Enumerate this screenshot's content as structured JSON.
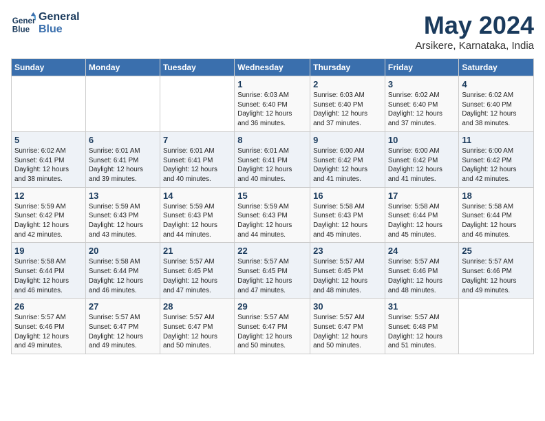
{
  "header": {
    "logo_line1": "General",
    "logo_line2": "Blue",
    "title": "May 2024",
    "location": "Arsikere, Karnataka, India"
  },
  "days_of_week": [
    "Sunday",
    "Monday",
    "Tuesday",
    "Wednesday",
    "Thursday",
    "Friday",
    "Saturday"
  ],
  "weeks": [
    [
      {
        "day": "",
        "info": ""
      },
      {
        "day": "",
        "info": ""
      },
      {
        "day": "",
        "info": ""
      },
      {
        "day": "1",
        "info": "Sunrise: 6:03 AM\nSunset: 6:40 PM\nDaylight: 12 hours\nand 36 minutes."
      },
      {
        "day": "2",
        "info": "Sunrise: 6:03 AM\nSunset: 6:40 PM\nDaylight: 12 hours\nand 37 minutes."
      },
      {
        "day": "3",
        "info": "Sunrise: 6:02 AM\nSunset: 6:40 PM\nDaylight: 12 hours\nand 37 minutes."
      },
      {
        "day": "4",
        "info": "Sunrise: 6:02 AM\nSunset: 6:40 PM\nDaylight: 12 hours\nand 38 minutes."
      }
    ],
    [
      {
        "day": "5",
        "info": "Sunrise: 6:02 AM\nSunset: 6:41 PM\nDaylight: 12 hours\nand 38 minutes."
      },
      {
        "day": "6",
        "info": "Sunrise: 6:01 AM\nSunset: 6:41 PM\nDaylight: 12 hours\nand 39 minutes."
      },
      {
        "day": "7",
        "info": "Sunrise: 6:01 AM\nSunset: 6:41 PM\nDaylight: 12 hours\nand 40 minutes."
      },
      {
        "day": "8",
        "info": "Sunrise: 6:01 AM\nSunset: 6:41 PM\nDaylight: 12 hours\nand 40 minutes."
      },
      {
        "day": "9",
        "info": "Sunrise: 6:00 AM\nSunset: 6:42 PM\nDaylight: 12 hours\nand 41 minutes."
      },
      {
        "day": "10",
        "info": "Sunrise: 6:00 AM\nSunset: 6:42 PM\nDaylight: 12 hours\nand 41 minutes."
      },
      {
        "day": "11",
        "info": "Sunrise: 6:00 AM\nSunset: 6:42 PM\nDaylight: 12 hours\nand 42 minutes."
      }
    ],
    [
      {
        "day": "12",
        "info": "Sunrise: 5:59 AM\nSunset: 6:42 PM\nDaylight: 12 hours\nand 42 minutes."
      },
      {
        "day": "13",
        "info": "Sunrise: 5:59 AM\nSunset: 6:43 PM\nDaylight: 12 hours\nand 43 minutes."
      },
      {
        "day": "14",
        "info": "Sunrise: 5:59 AM\nSunset: 6:43 PM\nDaylight: 12 hours\nand 44 minutes."
      },
      {
        "day": "15",
        "info": "Sunrise: 5:59 AM\nSunset: 6:43 PM\nDaylight: 12 hours\nand 44 minutes."
      },
      {
        "day": "16",
        "info": "Sunrise: 5:58 AM\nSunset: 6:43 PM\nDaylight: 12 hours\nand 45 minutes."
      },
      {
        "day": "17",
        "info": "Sunrise: 5:58 AM\nSunset: 6:44 PM\nDaylight: 12 hours\nand 45 minutes."
      },
      {
        "day": "18",
        "info": "Sunrise: 5:58 AM\nSunset: 6:44 PM\nDaylight: 12 hours\nand 46 minutes."
      }
    ],
    [
      {
        "day": "19",
        "info": "Sunrise: 5:58 AM\nSunset: 6:44 PM\nDaylight: 12 hours\nand 46 minutes."
      },
      {
        "day": "20",
        "info": "Sunrise: 5:58 AM\nSunset: 6:44 PM\nDaylight: 12 hours\nand 46 minutes."
      },
      {
        "day": "21",
        "info": "Sunrise: 5:57 AM\nSunset: 6:45 PM\nDaylight: 12 hours\nand 47 minutes."
      },
      {
        "day": "22",
        "info": "Sunrise: 5:57 AM\nSunset: 6:45 PM\nDaylight: 12 hours\nand 47 minutes."
      },
      {
        "day": "23",
        "info": "Sunrise: 5:57 AM\nSunset: 6:45 PM\nDaylight: 12 hours\nand 48 minutes."
      },
      {
        "day": "24",
        "info": "Sunrise: 5:57 AM\nSunset: 6:46 PM\nDaylight: 12 hours\nand 48 minutes."
      },
      {
        "day": "25",
        "info": "Sunrise: 5:57 AM\nSunset: 6:46 PM\nDaylight: 12 hours\nand 49 minutes."
      }
    ],
    [
      {
        "day": "26",
        "info": "Sunrise: 5:57 AM\nSunset: 6:46 PM\nDaylight: 12 hours\nand 49 minutes."
      },
      {
        "day": "27",
        "info": "Sunrise: 5:57 AM\nSunset: 6:47 PM\nDaylight: 12 hours\nand 49 minutes."
      },
      {
        "day": "28",
        "info": "Sunrise: 5:57 AM\nSunset: 6:47 PM\nDaylight: 12 hours\nand 50 minutes."
      },
      {
        "day": "29",
        "info": "Sunrise: 5:57 AM\nSunset: 6:47 PM\nDaylight: 12 hours\nand 50 minutes."
      },
      {
        "day": "30",
        "info": "Sunrise: 5:57 AM\nSunset: 6:47 PM\nDaylight: 12 hours\nand 50 minutes."
      },
      {
        "day": "31",
        "info": "Sunrise: 5:57 AM\nSunset: 6:48 PM\nDaylight: 12 hours\nand 51 minutes."
      },
      {
        "day": "",
        "info": ""
      }
    ]
  ]
}
